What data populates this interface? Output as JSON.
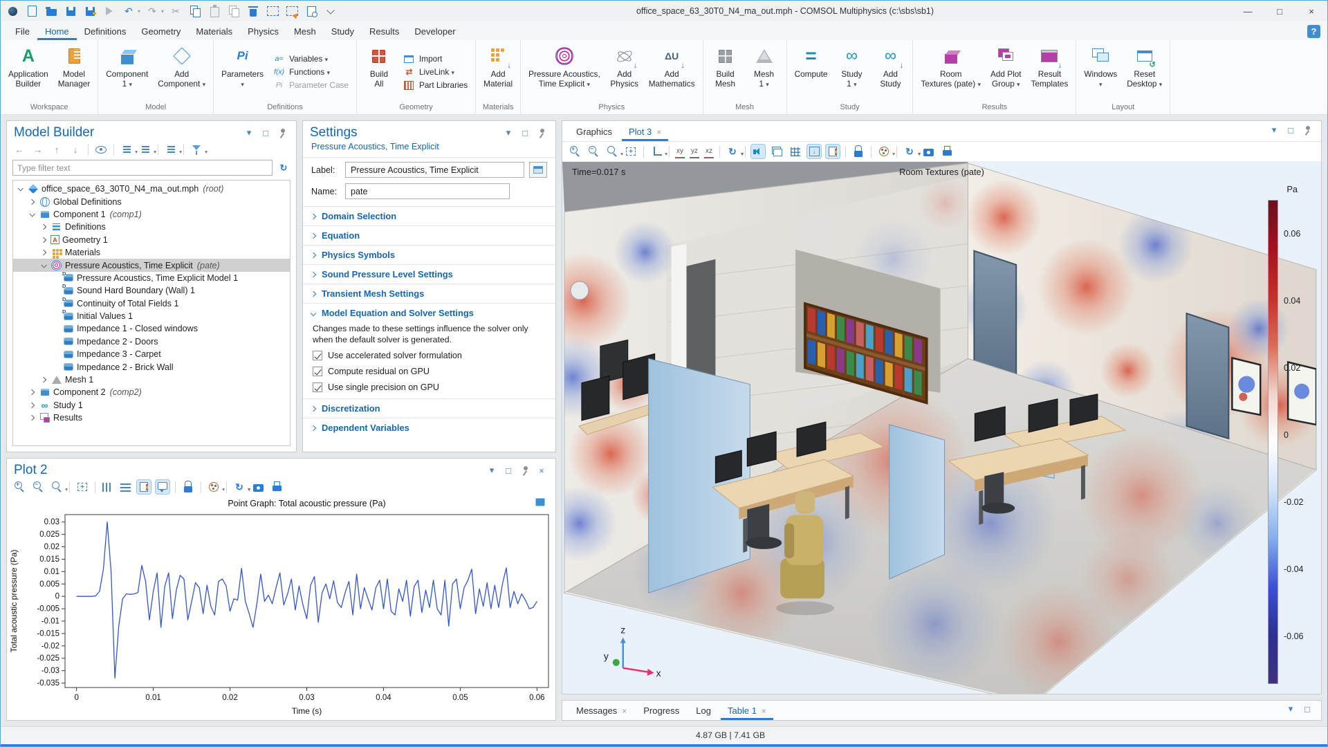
{
  "window": {
    "title": "office_space_63_30T0_N4_ma_out.mph - COMSOL Multiphysics (c:\\sbs\\sb1)",
    "memory": "4.87 GB | 7.41 GB",
    "controls": [
      {
        "name": "minimize",
        "glyph": "—"
      },
      {
        "name": "maximize",
        "glyph": "□"
      },
      {
        "name": "close",
        "glyph": "×"
      }
    ]
  },
  "titlebar": {
    "quick_icons": [
      {
        "n": "app-logo",
        "t": "qi-logo"
      },
      {
        "n": "new-file",
        "t": "qi-doc"
      },
      {
        "n": "open-file",
        "t": "qi-open"
      },
      {
        "n": "save",
        "t": "qi-save"
      },
      {
        "n": "save-as",
        "t": "qi-saveas"
      },
      {
        "n": "run",
        "t": "qi-run"
      },
      {
        "n": "undo",
        "g": "↶",
        "dd": true
      },
      {
        "n": "redo",
        "g": "↷",
        "gray": true,
        "dd": true
      },
      {
        "n": "cut",
        "g": "✂",
        "gray": true
      },
      {
        "n": "copy",
        "t": "qi-copy"
      },
      {
        "n": "paste",
        "t": "qi-paste"
      },
      {
        "n": "duplicate",
        "t": "qi-dup"
      },
      {
        "n": "delete",
        "t": "qi-del"
      },
      {
        "n": "select-box",
        "t": "qi-sel"
      },
      {
        "n": "clear-selection",
        "t": "qi-clearsel"
      },
      {
        "n": "find",
        "t": "qi-find"
      },
      {
        "n": "toolbar-overflow",
        "t": "qi-chev"
      }
    ]
  },
  "menubar": {
    "items": [
      "File",
      "Home",
      "Definitions",
      "Geometry",
      "Materials",
      "Physics",
      "Mesh",
      "Study",
      "Results",
      "Developer"
    ],
    "active": "Home",
    "help_glyph": "?"
  },
  "icon_glyphs": {
    "app-builder": "A",
    "parameters": "Pi",
    "compute": "=",
    "study": "∞",
    "add-study": "∞",
    "add-math": "ΔU",
    "variables": "a=",
    "functions": "f(x)",
    "param-case": "Pi",
    "livelink": "⇄"
  },
  "ribbon": {
    "groups": [
      {
        "label": "Workspace",
        "big": [
          {
            "label": "Application\nBuilder",
            "icon": "app-builder"
          },
          {
            "label": "Model\nManager",
            "icon": "model-manager"
          }
        ]
      },
      {
        "label": "Model",
        "big": [
          {
            "label": "Component\n1",
            "icon": "component",
            "dd": true
          },
          {
            "label": "Add\nComponent",
            "icon": "add-component",
            "dd": true
          }
        ]
      },
      {
        "label": "Definitions",
        "big": [
          {
            "label": "Parameters\n",
            "icon": "parameters",
            "dd": true
          }
        ],
        "small": [
          {
            "label": "Variables",
            "icon": "variables",
            "dd": true
          },
          {
            "label": "Functions",
            "icon": "functions",
            "dd": true
          },
          {
            "label": "Parameter Case",
            "icon": "param-case",
            "disabled": true
          }
        ]
      },
      {
        "label": "Geometry",
        "big": [
          {
            "label": "Build\nAll",
            "icon": "build-all"
          }
        ],
        "small": [
          {
            "label": "Import",
            "icon": "import"
          },
          {
            "label": "LiveLink",
            "icon": "livelink",
            "dd": true
          },
          {
            "label": "Part Libraries",
            "icon": "part-lib"
          }
        ]
      },
      {
        "label": "Materials",
        "big": [
          {
            "label": "Add\nMaterial",
            "icon": "add-material"
          }
        ]
      },
      {
        "label": "Physics",
        "big": [
          {
            "label": "Pressure Acoustics,\nTime Explicit",
            "icon": "acoustics",
            "dd": true
          },
          {
            "label": "Add\nPhysics",
            "icon": "add-physics"
          },
          {
            "label": "Add\nMathematics",
            "icon": "add-math"
          }
        ]
      },
      {
        "label": "Mesh",
        "big": [
          {
            "label": "Build\nMesh",
            "icon": "build-mesh"
          },
          {
            "label": "Mesh\n1",
            "icon": "mesh",
            "dd": true
          }
        ]
      },
      {
        "label": "Study",
        "big": [
          {
            "label": "Compute",
            "icon": "compute"
          },
          {
            "label": "Study\n1",
            "icon": "study",
            "dd": true
          },
          {
            "label": "Add\nStudy",
            "icon": "add-study"
          }
        ]
      },
      {
        "label": "Results",
        "big": [
          {
            "label": "Room\nTextures (pate)",
            "icon": "room-textures",
            "dd": true
          },
          {
            "label": "Add Plot\nGroup",
            "icon": "add-plot-group",
            "dd": true
          },
          {
            "label": "Result\nTemplates",
            "icon": "result-templates"
          }
        ]
      },
      {
        "label": "Layout",
        "big": [
          {
            "label": "Windows\n",
            "icon": "windows",
            "dd": true
          },
          {
            "label": "Reset\nDesktop",
            "icon": "reset-desktop",
            "dd": true
          }
        ]
      }
    ]
  },
  "model_builder": {
    "title": "Model Builder",
    "filter_placeholder": "Type filter text",
    "refresh_glyph": "↻",
    "toolbar": [
      {
        "n": "nav-back",
        "g": "←",
        "gray": true
      },
      {
        "n": "nav-forward",
        "g": "→",
        "gray": true
      },
      {
        "n": "move-up",
        "g": "↑",
        "gray": true
      },
      {
        "n": "move-down",
        "g": "↓",
        "gray": true
      },
      {
        "sep": true
      },
      {
        "n": "show",
        "t": "eye"
      },
      {
        "sep": true
      },
      {
        "n": "expand-all",
        "t": "lines",
        "dd": true
      },
      {
        "n": "collapse-all",
        "t": "lines",
        "dd": true
      },
      {
        "sep": true
      },
      {
        "n": "model-tree-node-text",
        "t": "lines",
        "dd": true
      },
      {
        "sep": true
      },
      {
        "n": "filter",
        "t": "funnel",
        "dd": true
      }
    ],
    "tree": [
      {
        "indent": 0,
        "exp": "open",
        "icon": "root",
        "label": "office_space_63_30T0_N4_ma_out.mph",
        "suffix": "(root)"
      },
      {
        "indent": 1,
        "exp": "closed",
        "icon": "globe",
        "label": "Global Definitions"
      },
      {
        "indent": 1,
        "exp": "open",
        "icon": "component",
        "label": "Component 1",
        "suffix": "(comp1)"
      },
      {
        "indent": 2,
        "exp": "closed",
        "icon": "definitions",
        "label": "Definitions"
      },
      {
        "indent": 2,
        "exp": "closed",
        "icon": "geometry",
        "label": "Geometry 1"
      },
      {
        "indent": 2,
        "exp": "closed",
        "icon": "materials",
        "label": "Materials"
      },
      {
        "indent": 2,
        "exp": "open",
        "icon": "acoustics",
        "label": "Pressure Acoustics, Time Explicit",
        "suffix": "(pate)",
        "selected": true
      },
      {
        "indent": 3,
        "exp": "none",
        "icon": "node-d",
        "label": "Pressure Acoustics, Time Explicit Model 1"
      },
      {
        "indent": 3,
        "exp": "none",
        "icon": "node-d",
        "label": "Sound Hard Boundary (Wall) 1"
      },
      {
        "indent": 3,
        "exp": "none",
        "icon": "node-d",
        "label": "Continuity of Total Fields 1"
      },
      {
        "indent": 3,
        "exp": "none",
        "icon": "node-d",
        "label": "Initial Values 1"
      },
      {
        "indent": 3,
        "exp": "none",
        "icon": "node",
        "label": "Impedance 1 - Closed windows"
      },
      {
        "indent": 3,
        "exp": "none",
        "icon": "node",
        "label": "Impedance 2 - Doors"
      },
      {
        "indent": 3,
        "exp": "none",
        "icon": "node",
        "label": "Impedance 3 - Carpet"
      },
      {
        "indent": 3,
        "exp": "none",
        "icon": "node",
        "label": "Impedance 2 - Brick Wall"
      },
      {
        "indent": 2,
        "exp": "closed",
        "icon": "mesh",
        "label": "Mesh 1"
      },
      {
        "indent": 1,
        "exp": "closed",
        "icon": "component",
        "label": "Component 2",
        "suffix": "(comp2)"
      },
      {
        "indent": 1,
        "exp": "closed",
        "icon": "study",
        "label": "Study 1"
      },
      {
        "indent": 1,
        "exp": "closed",
        "icon": "results",
        "label": "Results"
      }
    ]
  },
  "settings": {
    "title": "Settings",
    "subtitle": "Pressure Acoustics, Time Explicit",
    "label_caption": "Label:",
    "label_value": "Pressure Acoustics, Time Explicit",
    "name_caption": "Name:",
    "name_value": "pate",
    "sections": [
      {
        "title": "Domain Selection"
      },
      {
        "title": "Equation"
      },
      {
        "title": "Physics Symbols"
      },
      {
        "title": "Sound Pressure Level Settings"
      },
      {
        "title": "Transient Mesh Settings"
      },
      {
        "title": "Model Equation and Solver Settings",
        "expanded": true,
        "note": "Changes made to these settings influence the solver only when the default solver is generated.",
        "checkboxes": [
          {
            "label": "Use accelerated solver formulation",
            "checked": true
          },
          {
            "label": "Compute residual on GPU",
            "checked": true
          },
          {
            "label": "Use single precision on GPU",
            "checked": true
          }
        ]
      },
      {
        "title": "Discretization"
      },
      {
        "title": "Dependent Variables"
      }
    ]
  },
  "plot2": {
    "title": "Plot 2",
    "corner": [
      {
        "n": "collapse",
        "g": "▾"
      },
      {
        "n": "float",
        "g": "□"
      },
      {
        "n": "pin",
        "t": "pin"
      },
      {
        "n": "close",
        "g": "×"
      }
    ],
    "toolbar": [
      {
        "n": "zoom-in",
        "t": "mag",
        "s": "+"
      },
      {
        "n": "zoom-out",
        "t": "mag",
        "s": "−"
      },
      {
        "n": "zoom-box",
        "t": "mag",
        "dd": true
      },
      {
        "sep": true
      },
      {
        "n": "zoom-extents",
        "t": "extents"
      },
      {
        "sep": true
      },
      {
        "n": "x-axis-grid",
        "t": "gridv"
      },
      {
        "n": "y-axis-grid",
        "t": "gridh"
      },
      {
        "n": "color-legend",
        "t": "legend",
        "a": true
      },
      {
        "n": "annotation",
        "t": "note",
        "a": true
      },
      {
        "sep": true
      },
      {
        "n": "lock-axes",
        "t": "lock"
      },
      {
        "sep": true
      },
      {
        "n": "color-palette",
        "t": "palette",
        "dd": true
      },
      {
        "sep": true
      },
      {
        "n": "update-plot",
        "t": "sync",
        "g": "↻",
        "dd": true
      },
      {
        "n": "image-snapshot",
        "t": "cam"
      },
      {
        "n": "print",
        "t": "print"
      }
    ]
  },
  "chart_data": {
    "type": "line",
    "title": "Point Graph: Total acoustic pressure (Pa)",
    "xlabel": "Time (s)",
    "ylabel": "Total acoustic pressure (Pa)",
    "series_name": "Total acoustic pressure",
    "line_color": "#3355cc",
    "xlim": [
      0,
      0.06
    ],
    "ylim": [
      -0.035,
      0.03
    ],
    "grid": false,
    "legend_position": "none",
    "xticks": [
      0,
      0.01,
      0.02,
      0.03,
      0.04,
      0.05,
      0.06
    ],
    "yticks": [
      0.03,
      0.025,
      0.02,
      0.015,
      0.01,
      0.005,
      0,
      -0.005,
      -0.01,
      -0.015,
      -0.02,
      -0.025,
      -0.03,
      -0.035
    ],
    "t0": 0,
    "dt": 0.0005,
    "values": [
      0,
      0,
      0,
      0,
      0,
      0.0002,
      0.002,
      0.011,
      0.03,
      0.01,
      -0.033,
      -0.012,
      -0.001,
      0.001,
      0.0008,
      0.001,
      0.0015,
      0.0125,
      0.006,
      -0.0095,
      0.002,
      0.0095,
      -0.0125,
      0.004,
      0.0095,
      -0.009,
      0.0025,
      0.0085,
      0.007,
      -0.0095,
      -0.002,
      0.0055,
      0.0035,
      -0.007,
      0.0045,
      -0.004,
      -0.0075,
      0.006,
      0.007,
      0.0042,
      -0.006,
      -0.001,
      -0.0015,
      0.0113,
      -0.002,
      -0.007,
      -0.0125,
      -0.003,
      0.009,
      -0.002,
      0.0005,
      -0.003,
      0.0035,
      0.0095,
      -0.0035,
      0.001,
      0.007,
      -0.0055,
      0.0042,
      -0.0035,
      -0.009,
      0.0045,
      0.008,
      -0.0105,
      0.0015,
      0.005,
      -0.001,
      0.0063,
      -0.0025,
      -0.0045,
      0.0015,
      0.006,
      -0.0075,
      0.009,
      -0.005,
      0.0035,
      -0.0012,
      -0.0055,
      0.0035,
      0.0065,
      -0.005,
      0.007,
      -0.006,
      -0.0075,
      0.003,
      -0.002,
      0.0065,
      -0.008,
      0.004,
      0.0065,
      -0.0065,
      0.0025,
      -0.0045,
      0.0065,
      -0.005,
      -0.0075,
      0.0065,
      -0.012,
      0.005,
      0.007,
      -0.005,
      0.0035,
      0.0065,
      0.011,
      -0.007,
      0.003,
      -0.004,
      0.0055,
      -0.005,
      0.0045,
      -0.0045,
      0.005,
      0.0115,
      -0.0045,
      0.002,
      -0.003,
      0.001,
      -0.0015,
      -0.005,
      -0.0045,
      -0.002
    ]
  },
  "graphics": {
    "tabs": [
      {
        "label": "Graphics"
      },
      {
        "label": "Plot 3",
        "active": true,
        "closable": true
      }
    ],
    "corner": [
      {
        "n": "collapse",
        "g": "▾"
      },
      {
        "n": "float",
        "g": "□"
      },
      {
        "n": "pin",
        "t": "pin"
      }
    ],
    "toolbar": [
      {
        "n": "zoom-in",
        "t": "mag",
        "s": "+"
      },
      {
        "n": "zoom-out",
        "t": "mag",
        "s": "−"
      },
      {
        "n": "zoom-box",
        "t": "mag",
        "dd": true
      },
      {
        "n": "zoom-extents",
        "t": "extents"
      },
      {
        "sep": true
      },
      {
        "n": "default-view",
        "t": "axes",
        "dd": true
      },
      {
        "sep": true
      },
      {
        "n": "view-xy",
        "g": "xy",
        "cls": "ax"
      },
      {
        "n": "view-yz",
        "g": "yz",
        "cls": "ax"
      },
      {
        "n": "view-xz",
        "g": "xz",
        "cls": "ax"
      },
      {
        "sep": true
      },
      {
        "n": "rotate-view",
        "t": "sync",
        "g": "↻",
        "dd": true
      },
      {
        "sep": true
      },
      {
        "n": "play-sound",
        "t": "speaker",
        "a": true
      },
      {
        "n": "scene-light",
        "t": "scene3"
      },
      {
        "n": "show-grid",
        "t": "grid3"
      },
      {
        "n": "show-material-color",
        "t": "downbox",
        "a": true
      },
      {
        "n": "color-legend",
        "t": "legend",
        "a": true
      },
      {
        "sep": true
      },
      {
        "n": "lock-view",
        "t": "lock"
      },
      {
        "sep": true
      },
      {
        "n": "color-palette",
        "t": "palette",
        "dd": true
      },
      {
        "sep": true
      },
      {
        "n": "update-plot",
        "t": "sync",
        "g": "↻",
        "dd": true
      },
      {
        "n": "image-snapshot",
        "t": "cam"
      },
      {
        "n": "print",
        "t": "print"
      }
    ],
    "time_label": "Time=0.017 s",
    "plot_title": "Room Textures (pate)",
    "axis": {
      "x": "x",
      "y": "y",
      "z": "z"
    },
    "colorbar": {
      "unit": "Pa",
      "ticks": [
        "0.06",
        "0.04",
        "0.02",
        "0",
        "-0.02",
        "-0.04",
        "-0.06"
      ],
      "gradient": [
        "#6e0f1e",
        "#a4121f",
        "#c33128",
        "#dd6a55",
        "#f3d3cb",
        "#ffffff",
        "#d3e2f7",
        "#83aef0",
        "#3c50d8",
        "#2c2f96",
        "#403082"
      ]
    }
  },
  "bottom_tabs": {
    "tabs": [
      {
        "label": "Messages",
        "closable": true
      },
      {
        "label": "Progress"
      },
      {
        "label": "Log"
      },
      {
        "label": "Table 1",
        "active": true,
        "closable": true
      }
    ],
    "corner": [
      {
        "n": "collapse",
        "g": "▾"
      },
      {
        "n": "float",
        "g": "□"
      }
    ]
  }
}
